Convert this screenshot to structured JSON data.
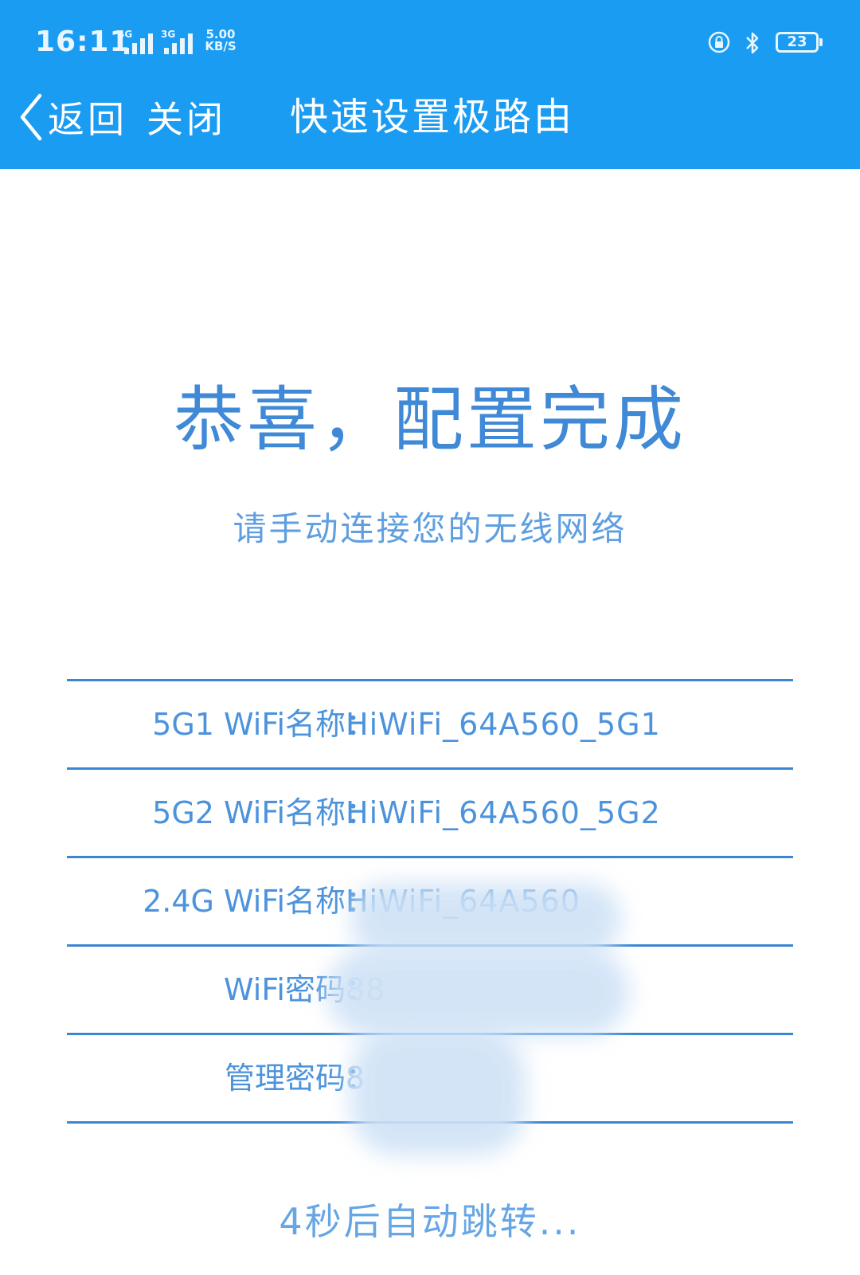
{
  "status_bar": {
    "time": "16:11",
    "signal_1_type": "4G",
    "signal_2_type": "3G",
    "net_speed_value": "5.00",
    "net_speed_unit": "KB/S",
    "battery_level": "23"
  },
  "nav": {
    "back_label": "返回",
    "close_label": "关闭",
    "title": "快速设置极路由"
  },
  "headline": "恭喜，配置完成",
  "subheadline": "请手动连接您的无线网络",
  "info_rows": [
    {
      "label": "5G1 WiFi名称：",
      "value": "HiWiFi_64A560_5G1"
    },
    {
      "label": "5G2 WiFi名称：",
      "value": "HiWiFi_64A560_5G2"
    },
    {
      "label": "2.4G WiFi名称：",
      "value": "HiWiFi_64A560"
    },
    {
      "label": "WiFi密码：",
      "value": "88"
    },
    {
      "label": "管理密码：",
      "value": "8"
    }
  ],
  "redirect_text": "4秒后自动跳转...",
  "colors": {
    "header_bg": "#1a9cf2",
    "accent_text": "#3f89d6",
    "divider": "#3b86d2"
  }
}
